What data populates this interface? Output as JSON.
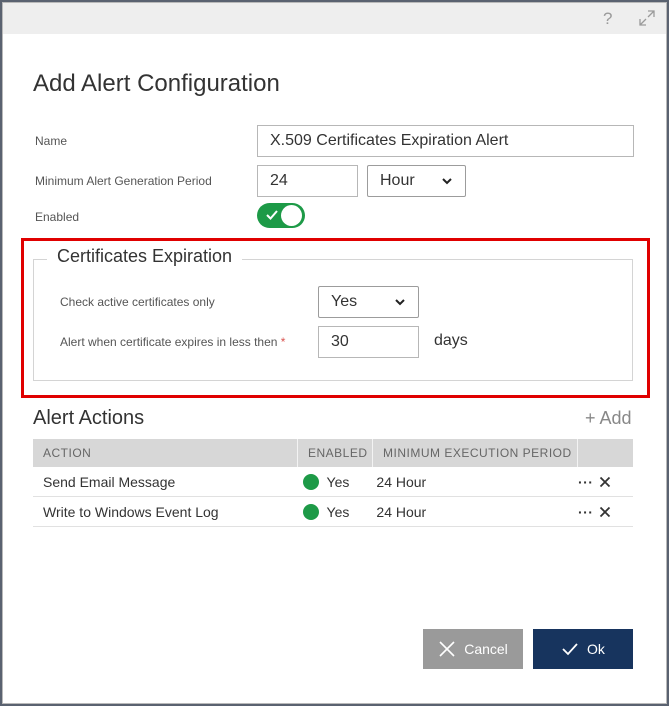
{
  "titlebar": {
    "help_glyph": "?",
    "expand_icon": "expand-icon"
  },
  "dialog": {
    "title": "Add Alert Configuration"
  },
  "form": {
    "name_label": "Name",
    "name_value": "X.509 Certificates Expiration Alert",
    "period_label": "Minimum Alert Generation Period",
    "period_value": "24",
    "period_unit": "Hour",
    "enabled_label": "Enabled",
    "enabled": true
  },
  "cert": {
    "legend": "Certificates Expiration",
    "active_only_label": "Check active certificates only",
    "active_only_value": "Yes",
    "expires_label": "Alert when certificate expires in less then",
    "required_mark": "*",
    "expires_value": "30",
    "expires_unit": "days"
  },
  "actions": {
    "title": "Alert Actions",
    "add_label": "+ Add",
    "columns": [
      "ACTION",
      "ENABLED",
      "MINIMUM EXECUTION PERIOD",
      ""
    ],
    "rows": [
      {
        "action": "Send Email Message",
        "enabled": "Yes",
        "period": "24 Hour"
      },
      {
        "action": "Write to Windows Event Log",
        "enabled": "Yes",
        "period": "24 Hour"
      }
    ],
    "more_glyph": "···"
  },
  "buttons": {
    "cancel": "Cancel",
    "ok": "Ok"
  },
  "colors": {
    "accent": "#17345e",
    "success": "#1d9a47",
    "highlight": "#e00000"
  }
}
